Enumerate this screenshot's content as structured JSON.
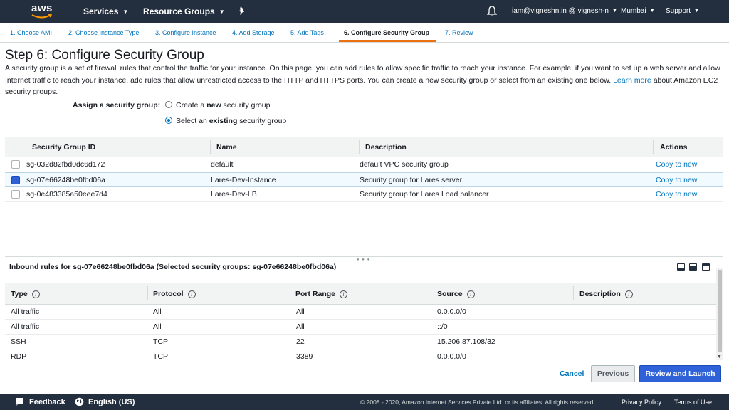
{
  "topnav": {
    "logo": "aws",
    "services": "Services",
    "resource_groups": "Resource Groups",
    "account": "iam@vigneshn.in @ vignesh-n",
    "region": "Mumbai",
    "support": "Support",
    "icons": [
      "bell-icon",
      "pin-icon",
      "caret-down-icon"
    ]
  },
  "wizard": {
    "tabs": [
      {
        "label": "1. Choose AMI"
      },
      {
        "label": "2. Choose Instance Type"
      },
      {
        "label": "3. Configure Instance"
      },
      {
        "label": "4. Add Storage"
      },
      {
        "label": "5. Add Tags"
      },
      {
        "label": "6. Configure Security Group",
        "active": true
      },
      {
        "label": "7. Review"
      }
    ],
    "accent_color": "#ec7211"
  },
  "step": {
    "title": "Step 6: Configure Security Group",
    "desc_part1": "A security group is a set of firewall rules that control the traffic for your instance. On this page, you can add rules to allow specific traffic to reach your instance. For example, if you want to set up a web server and allow Internet traffic to reach your instance, add rules that allow unrestricted access to the HTTP and HTTPS ports. You can create a new security group or select from an existing one below.",
    "learn_more": "Learn more",
    "desc_part2": "about Amazon EC2 security groups."
  },
  "assign": {
    "label": "Assign a security group:",
    "opt_create_pre": "Create a ",
    "opt_create_bold": "new",
    "opt_create_post": " security group",
    "opt_select_pre": "Select an ",
    "opt_select_bold": "existing",
    "opt_select_post": " security group",
    "selected": "existing"
  },
  "sg_table": {
    "headers": {
      "id": "Security Group ID",
      "name": "Name",
      "description": "Description",
      "actions": "Actions"
    },
    "rows": [
      {
        "id": "sg-032d82fbd0dc6d172",
        "name": "default",
        "description": "default VPC security group",
        "action": "Copy to new",
        "selected": false
      },
      {
        "id": "sg-07e66248be0fbd06a",
        "name": "Lares-Dev-Instance",
        "description": "Security group for Lares server",
        "action": "Copy to new",
        "selected": true
      },
      {
        "id": "sg-0e483385a50eee7d4",
        "name": "Lares-Dev-LB",
        "description": "Security group for Lares Load balancer",
        "action": "Copy to new",
        "selected": false
      }
    ]
  },
  "inbound": {
    "title": "Inbound rules for sg-07e66248be0fbd06a (Selected security groups: sg-07e66248be0fbd06a)",
    "headers": {
      "type": "Type",
      "protocol": "Protocol",
      "port_range": "Port Range",
      "source": "Source",
      "description": "Description"
    },
    "info_glyph": "i",
    "rows": [
      {
        "type": "All traffic",
        "protocol": "All",
        "port": "All",
        "source": "0.0.0.0/0"
      },
      {
        "type": "All traffic",
        "protocol": "All",
        "port": "All",
        "source": "::/0"
      },
      {
        "type": "SSH",
        "protocol": "TCP",
        "port": "22",
        "source": "15.206.87.108/32"
      },
      {
        "type": "RDP",
        "protocol": "TCP",
        "port": "3389",
        "source": "0.0.0.0/0"
      }
    ]
  },
  "actions": {
    "cancel": "Cancel",
    "previous": "Previous",
    "review_launch": "Review and Launch",
    "primary_color": "#2f62d8"
  },
  "footer": {
    "feedback": "Feedback",
    "language": "English (US)",
    "copyright": "© 2008 - 2020, Amazon Internet Services Private Ltd. or its affiliates. All rights reserved.",
    "privacy": "Privacy Policy",
    "terms": "Terms of Use"
  }
}
